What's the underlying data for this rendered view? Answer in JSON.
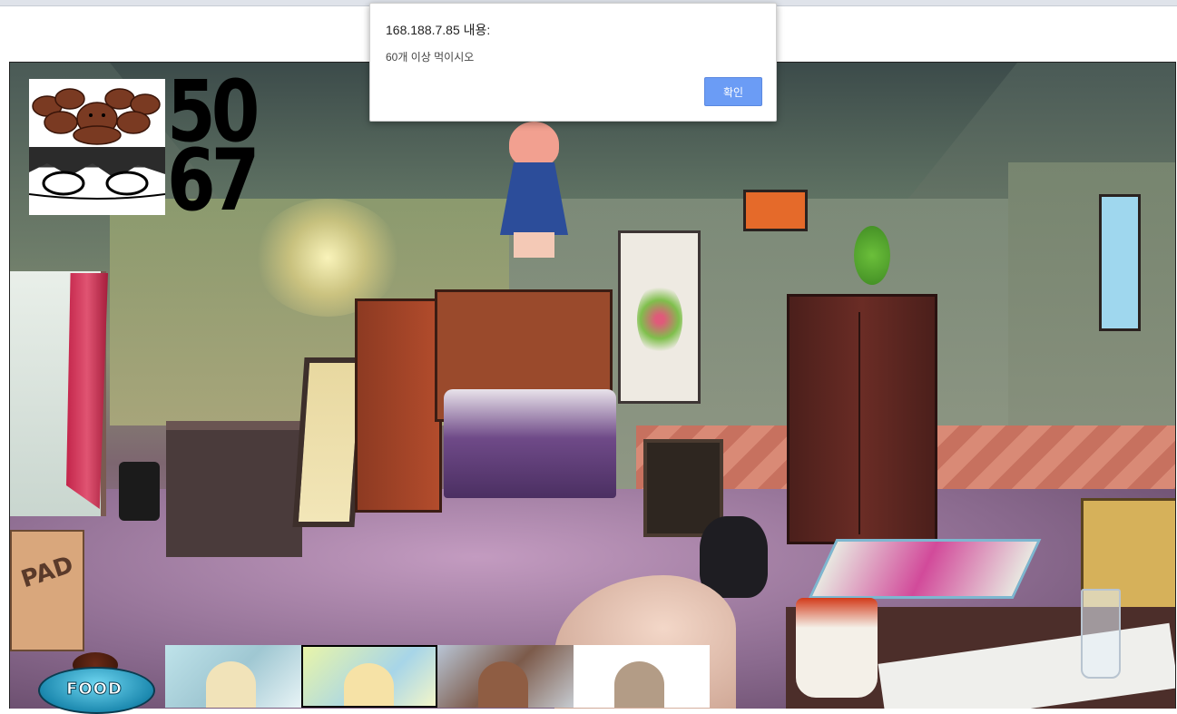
{
  "dialog": {
    "title": "168.188.7.85 내용:",
    "message": "60개 이상 먹이시오",
    "ok_label": "확인"
  },
  "hud": {
    "food_count": "50",
    "time_remaining": "67"
  },
  "scene": {
    "pad_box_label": "PAD",
    "food_bowl_label": "FOOD"
  },
  "cards": [
    {
      "name": "character-card-1"
    },
    {
      "name": "character-card-2",
      "selected": true
    },
    {
      "name": "character-card-3"
    },
    {
      "name": "character-card-4"
    }
  ],
  "colors": {
    "dialog_button": "#6b9cf5",
    "hud_text": "#000000"
  }
}
